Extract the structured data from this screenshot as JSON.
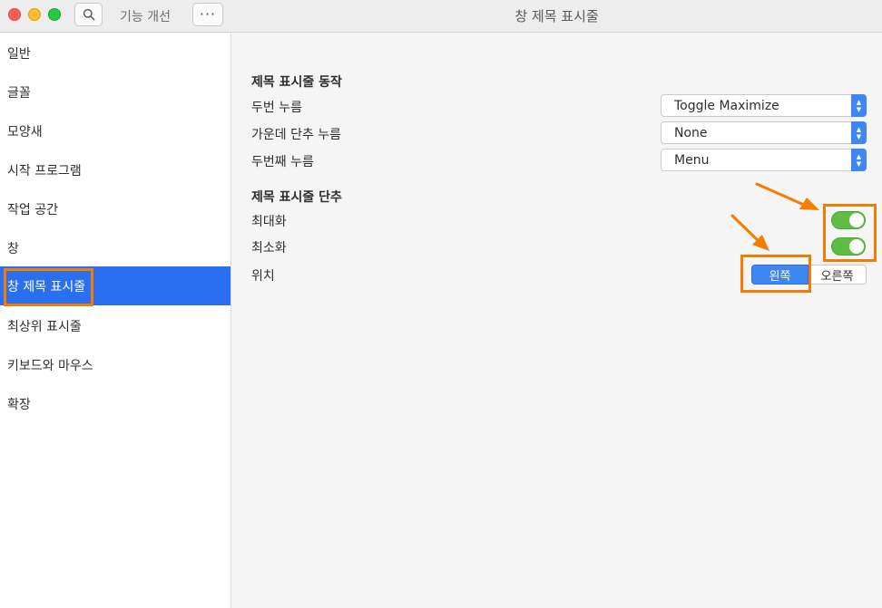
{
  "titlebar": {
    "app_name": "기능 개선",
    "title": "창 제목 표시줄",
    "more_label": "···"
  },
  "sidebar": {
    "items": [
      {
        "label": "일반"
      },
      {
        "label": "글꼴"
      },
      {
        "label": "모양새"
      },
      {
        "label": "시작 프로그램"
      },
      {
        "label": "작업 공간"
      },
      {
        "label": "창"
      },
      {
        "label": "창 제목 표시줄",
        "selected": true
      },
      {
        "label": "최상위 표시줄"
      },
      {
        "label": "키보드와 마우스"
      },
      {
        "label": "확장"
      }
    ]
  },
  "actions": {
    "title": "제목 표시줄 동작",
    "double_click": {
      "label": "두번 누름",
      "value": "Toggle Maximize"
    },
    "middle_click": {
      "label": "가운데 단추 누름",
      "value": "None"
    },
    "secondary_click": {
      "label": "두번째 누름",
      "value": "Menu"
    }
  },
  "buttons": {
    "title": "제목 표시줄 단추",
    "maximize": {
      "label": "최대화",
      "enabled": true
    },
    "minimize": {
      "label": "최소화",
      "enabled": true
    },
    "placement": {
      "label": "위치",
      "left": "왼쪽",
      "right": "오른쪽",
      "selected": "왼쪽"
    }
  },
  "colors": {
    "accent": "#2a6ff0",
    "switch_on": "#5fbd43",
    "highlight": "#f57c00"
  },
  "icons": {
    "search": "search-icon",
    "combo": "up-down-chevron-icon",
    "annotation": "arrow-icon"
  }
}
